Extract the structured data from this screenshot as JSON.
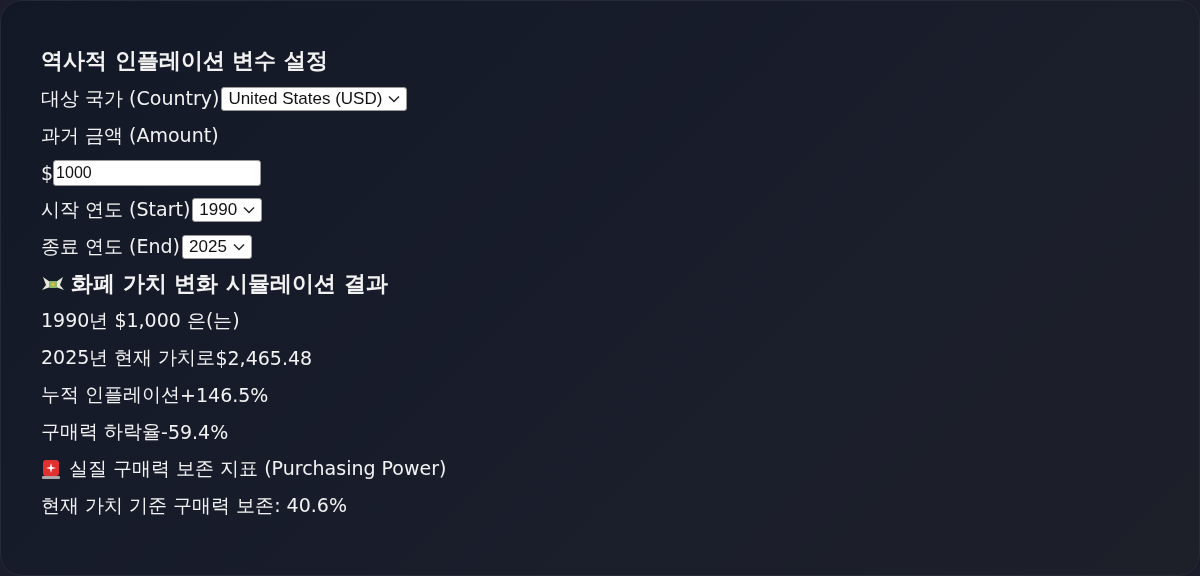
{
  "settings": {
    "title": "역사적 인플레이션 변수 설정",
    "fields": [
      {
        "kind": "select",
        "label": "대상 국가 (Country)",
        "value": "United States (USD)"
      },
      {
        "kind": "label",
        "label": "과거 금액 (Amount)"
      },
      {
        "kind": "input",
        "prefix": "$",
        "value": "1000"
      },
      {
        "kind": "select",
        "label": "시작 연도 (Start)",
        "value": "1990"
      },
      {
        "kind": "select",
        "label": "종료 연도 (End)",
        "value": "2025"
      }
    ]
  },
  "result": {
    "title": "화폐 가치 변화 시뮬레이션 결과",
    "lines": [
      {
        "label": "1990년 $1,000 은(는)"
      },
      {
        "label": "2025년 현재 가치로",
        "value": "$2,465.48"
      },
      {
        "label": "누적 인플레이션",
        "value": "+146.5%"
      },
      {
        "label": "구매력 하락율",
        "value": "-59.4%"
      }
    ]
  },
  "power": {
    "title": "실질 구매력 보존 지표 (Purchasing Power)",
    "text": "현재 가치 기준 구매력 보존: 40.6%"
  }
}
